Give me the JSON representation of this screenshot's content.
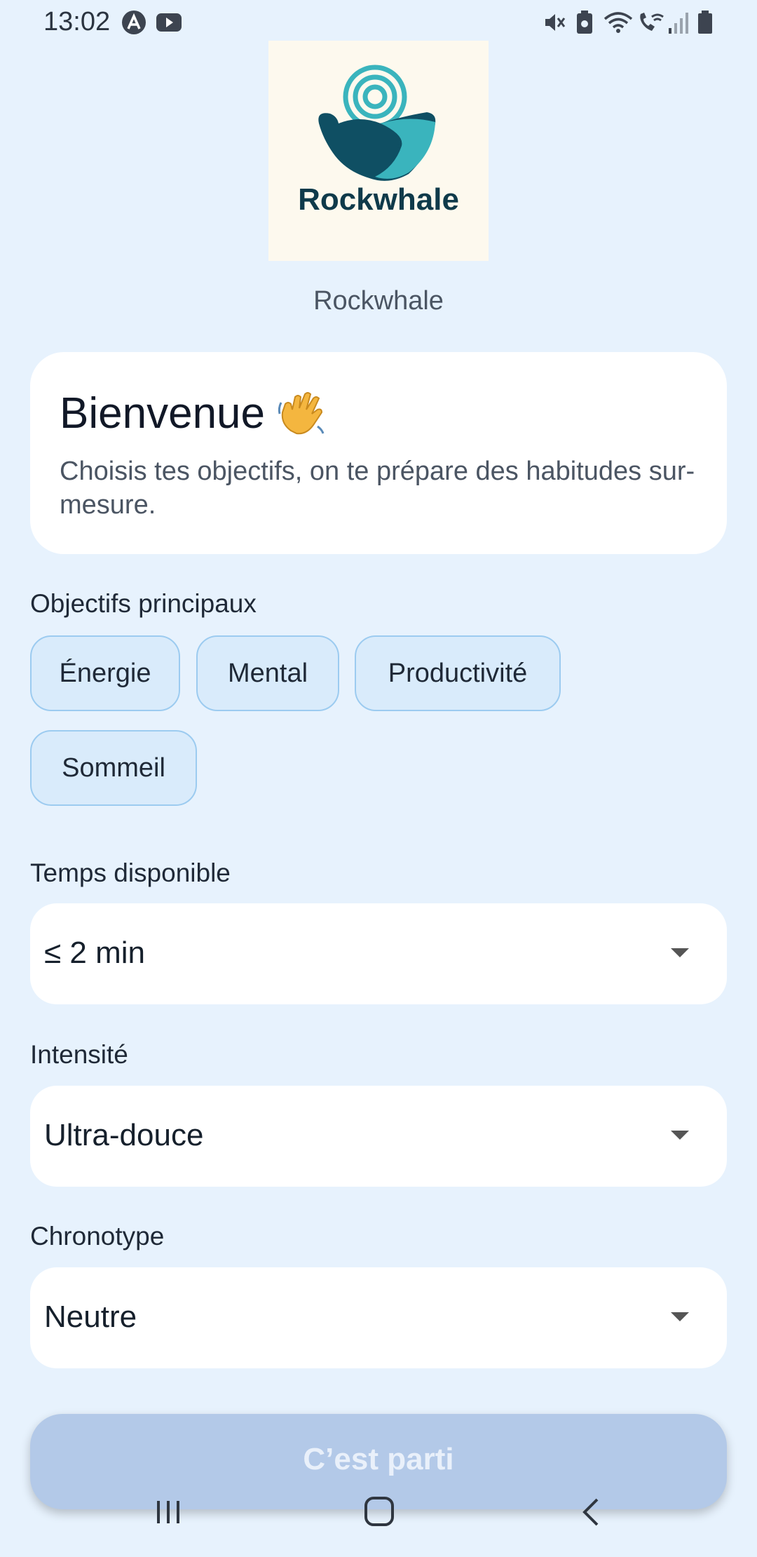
{
  "status_bar": {
    "time": "13:02",
    "icons_left": [
      "app-notification-icon",
      "youtube-icon"
    ],
    "icons_right": [
      "mute-icon",
      "battery-saver-icon",
      "wifi-icon",
      "wifi-call-icon",
      "signal-icon",
      "battery-icon"
    ]
  },
  "app": {
    "logo_text": "Rockwhale",
    "name": "Rockwhale"
  },
  "welcome": {
    "title": "Bienvenue",
    "emoji": "waving-hand",
    "subtitle": "Choisis tes objectifs, on te prépare des habitudes sur-mesure."
  },
  "goals": {
    "label": "Objectifs principaux",
    "chips": [
      "Énergie",
      "Mental",
      "Productivité",
      "Sommeil"
    ]
  },
  "time_available": {
    "label": "Temps disponible",
    "value": "≤ 2 min"
  },
  "intensity": {
    "label": "Intensité",
    "value": "Ultra-douce"
  },
  "chronotype": {
    "label": "Chronotype",
    "value": "Neutre"
  },
  "cta": {
    "label": "C’est parti"
  },
  "colors": {
    "background": "#e7f2fd",
    "chip_bg": "#d9ebfb",
    "chip_border": "#9ccbf0",
    "cta_disabled": "#b3c9e8",
    "logo_teal": "#3ab4bd",
    "logo_navy": "#0f4f63"
  },
  "nav_bar": {
    "buttons": [
      "recents-icon",
      "home-icon",
      "back-icon"
    ]
  }
}
